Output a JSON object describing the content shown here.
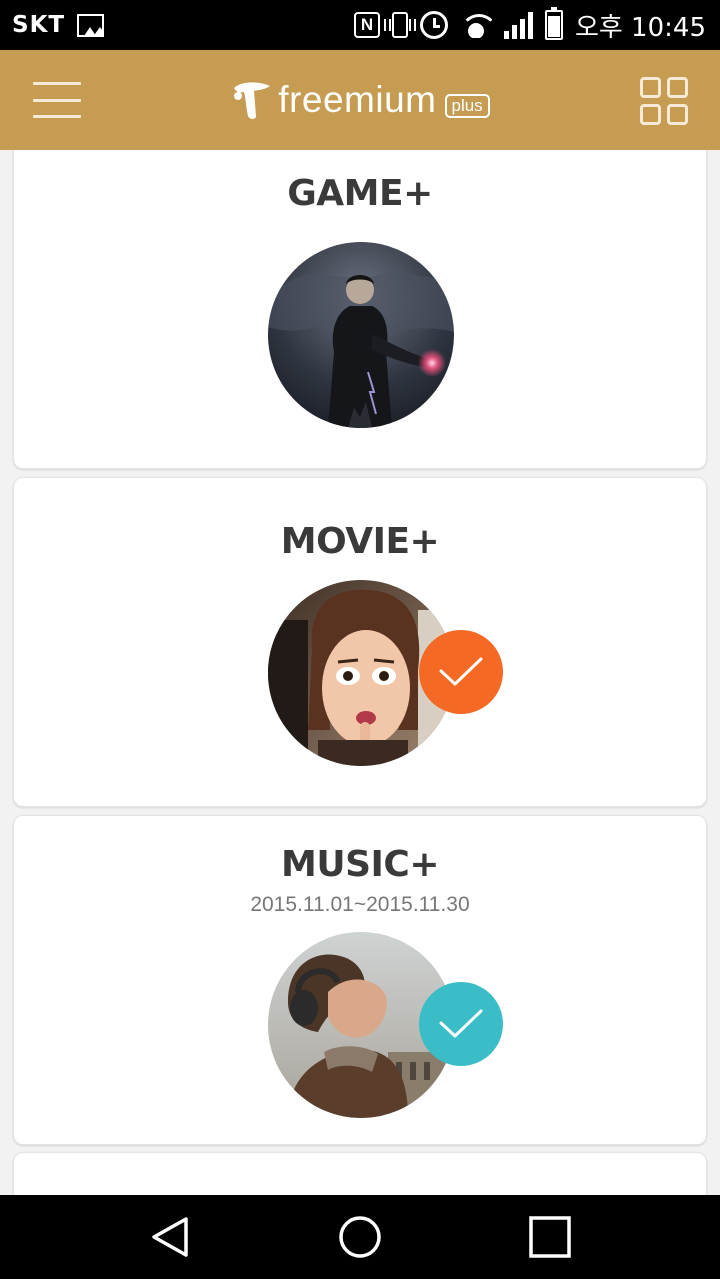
{
  "status_bar": {
    "carrier": "SKT",
    "time": "오후 10:45",
    "icons": [
      "gallery-icon",
      "nfc-icon",
      "vibrate-icon",
      "alarm-icon",
      "wifi-icon",
      "signal-icon",
      "battery-icon"
    ],
    "nfc_glyph": "N"
  },
  "header": {
    "brand": "freemium",
    "brand_tag": "plus",
    "background": "#c59c51",
    "icons": [
      "menu-icon",
      "grid-icon"
    ]
  },
  "cards": [
    {
      "title": "GAME+",
      "subtitle": "",
      "selected": false,
      "check_color": ""
    },
    {
      "title": "MOVIE+",
      "subtitle": "",
      "selected": true,
      "check_color": "#f46a24"
    },
    {
      "title": "MUSIC+",
      "subtitle": "2015.11.01~2015.11.30",
      "selected": true,
      "check_color": "#3bbdc8"
    }
  ],
  "nav_bar": {
    "icons": [
      "back-icon",
      "home-icon",
      "recents-icon"
    ]
  }
}
